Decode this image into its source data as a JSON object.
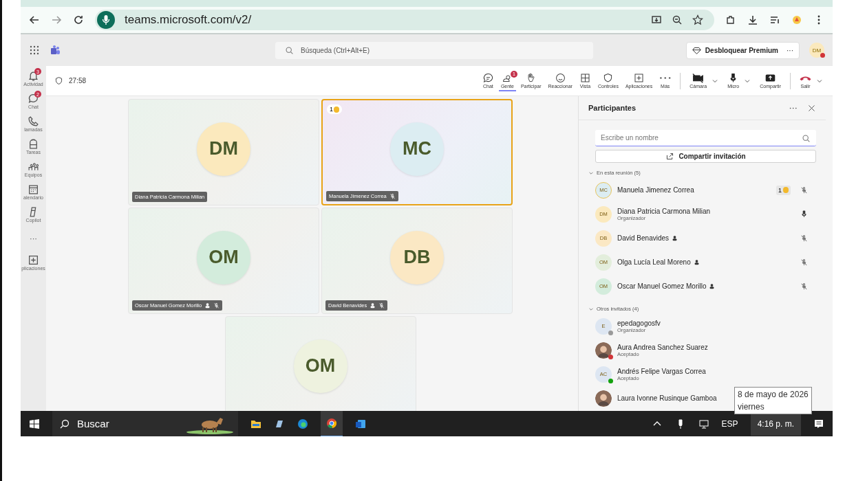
{
  "browser": {
    "url": "teams.microsoft.com/v2/"
  },
  "teams_bar": {
    "search_placeholder": "Búsqueda (Ctrl+Alt+E)",
    "premium_button": "Desbloquear Premium",
    "more": "···",
    "user_initials": "DM"
  },
  "rail": [
    {
      "label": "Actividad",
      "badge": "3"
    },
    {
      "label": "Chat",
      "badge": "2"
    },
    {
      "label": "lamadas"
    },
    {
      "label": "Tareas"
    },
    {
      "label": "Equipos"
    },
    {
      "label": "alendario"
    },
    {
      "label": "Copilot"
    },
    {
      "label": "···"
    },
    {
      "label": "plicaciones"
    }
  ],
  "timer": "27:58",
  "toolbar": [
    {
      "label": "Chat",
      "selected": false
    },
    {
      "label": "Gente",
      "selected": true,
      "badge": "1"
    },
    {
      "label": "Participar",
      "selected": false
    },
    {
      "label": "Reaccionar",
      "selected": false
    },
    {
      "label": "Vista",
      "selected": false
    },
    {
      "label": "Controles",
      "selected": false
    },
    {
      "label": "Aplicaciones",
      "selected": false
    },
    {
      "label": "Más",
      "selected": false
    }
  ],
  "media": [
    {
      "label": "Cámara"
    },
    {
      "label": "Micro"
    },
    {
      "label": "Compartir"
    }
  ],
  "leave": {
    "label": "Salir"
  },
  "tiles": [
    {
      "initials": "DM",
      "name": "Diana Patricia Carmona Milian",
      "color": "#fbe9bd",
      "active": false
    },
    {
      "initials": "MC",
      "name": "Manuela Jimenez Correa",
      "color": "#dcedf2",
      "muted": true,
      "active": true,
      "hand": "1"
    },
    {
      "initials": "OM",
      "name": "Oscar Manuel Gomez Morillo",
      "color": "#d3ecdc",
      "muted": true,
      "immersive": true,
      "active": false
    },
    {
      "initials": "DB",
      "name": "David Benavides",
      "color": "#fbe8c4",
      "muted": true,
      "immersive": true,
      "active": false
    },
    {
      "initials": "OM",
      "color": "#eef2df",
      "active": false
    }
  ],
  "panel": {
    "title": "Participantes",
    "search_placeholder": "Escribe un nombre",
    "share_button": "Compartir invitación",
    "sections": [
      {
        "title": "En esta reunión (5)",
        "expanded": true,
        "people": [
          {
            "initials": "MC",
            "name": "Manuela Jimenez Correa",
            "muted": true,
            "hand": "1",
            "speaking": true
          },
          {
            "initials": "DM",
            "name": "Diana Patricia Carmona Milian",
            "subtitle": "Organizador",
            "muted": false,
            "speaking": false
          },
          {
            "initials": "DB",
            "name": "David Benavides",
            "muted": true,
            "immersive": true,
            "speaking": false
          },
          {
            "initials": "OM",
            "name": "Olga Lucía Leal Moreno",
            "muted": true,
            "immersive": true,
            "speaking": false
          },
          {
            "initials": "OM",
            "name": "Oscar Manuel Gomez Morillo",
            "muted": true,
            "immersive": true,
            "speaking": false
          }
        ]
      },
      {
        "title": "Otros invitados (4)",
        "expanded": true,
        "people": [
          {
            "initials": "E",
            "name": "epedagogosfv",
            "subtitle": "Organizador",
            "color": "#9a9a9a"
          },
          {
            "kind": "picture",
            "name": "Aura Andrea Sanchez Suarez",
            "subtitle": "Aceptado",
            "color": "#d13438"
          },
          {
            "initials": "AC",
            "name": "Andrés Felipe Vargas Correa",
            "subtitle": "Aceptado",
            "color": "#13a10e"
          },
          {
            "kind": "picture",
            "name": "Laura Ivonne Rusinque Gamboa"
          }
        ]
      }
    ]
  },
  "tooltip": [
    "8 de mayo de 2026",
    "viernes"
  ],
  "taskbar": {
    "search": "Buscar",
    "language": "ESP",
    "time": "4:16 p. m."
  }
}
